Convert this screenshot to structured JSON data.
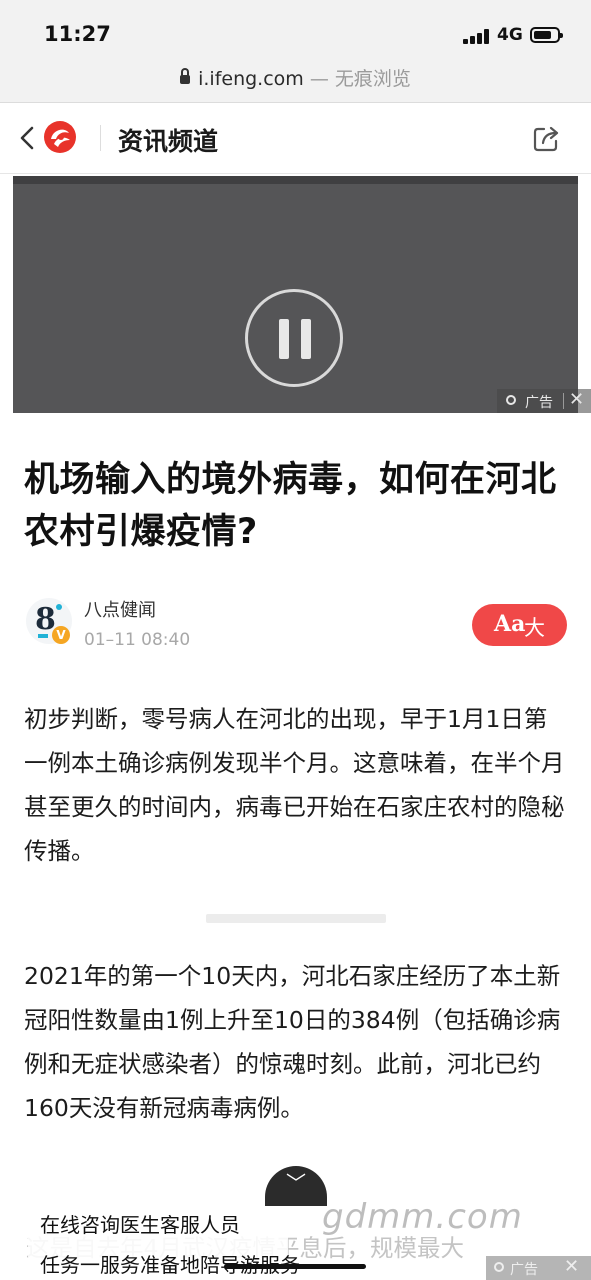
{
  "status": {
    "time": "11:27",
    "network": "4G"
  },
  "browser": {
    "url": "i.ifeng.com",
    "mode": "— 无痕浏览"
  },
  "nav": {
    "back_icon": "chevron-left-icon",
    "logo": "ifeng-phoenix-logo",
    "channel": "资讯频道",
    "share_icon": "share-icon"
  },
  "video": {
    "state": "playing",
    "pause_icon": "pause-icon",
    "ad_label": "广告"
  },
  "article": {
    "title": "机场输入的境外病毒，如何在河北农村引爆疫情?",
    "author": "八点健闻",
    "date": "01–11 08:40",
    "font_button": {
      "icon": "Aa",
      "label": "大"
    },
    "paragraphs": [
      "初步判断，零号病人在河北的出现，早于1月1日第一例本土确诊病例发现半个月。这意味着，在半个月甚至更久的时间内，病毒已开始在石家庄农村的隐秘传播。",
      "2021年的第一个10天内，河北石家庄经历了本土新冠阳性数量由1例上升至10日的384例（包括确诊病例和无症状感染者）的惊魂时刻。此前，河北已约160天没有新冠病毒病例。"
    ]
  },
  "bottom_ad": {
    "line1": "在线咨询医生客服人员",
    "line2": "任务一服务准备地陪导游服务",
    "ghost_text": "这是自去年4月武汉疫情平息后，规模最大",
    "ad_label": "广告",
    "watermark": "gdmm.com"
  },
  "colors": {
    "accent": "#f04848",
    "video_bg": "#555557",
    "chrome_bg": "#f2f2f2"
  }
}
